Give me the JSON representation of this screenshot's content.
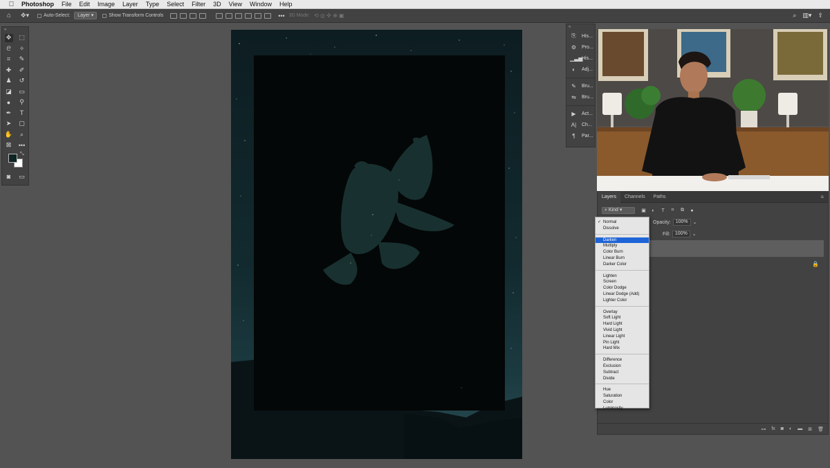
{
  "menubar": {
    "apple_icon": "apple-icon",
    "items": [
      "Photoshop",
      "File",
      "Edit",
      "Image",
      "Layer",
      "Type",
      "Select",
      "Filter",
      "3D",
      "View",
      "Window",
      "Help"
    ]
  },
  "options": {
    "auto_select_label": "Auto-Select:",
    "auto_select_value": "Layer",
    "show_transform_label": "Show Transform Controls",
    "mode_3d_label": "3D Mode:"
  },
  "mini_panels": [
    "His...",
    "Pro...",
    "His...",
    "Adj...",
    "Bru...",
    "Bru...",
    "Act...",
    "Ch...",
    "Par..."
  ],
  "layers": {
    "tabs": [
      "Layers",
      "Channels",
      "Paths"
    ],
    "kind_label": "Kind",
    "opacity_label": "Opacity:",
    "opacity_value": "100%",
    "fill_label": "Fill:",
    "fill_value": "100%"
  },
  "blend_modes": {
    "groups": [
      [
        "Normal",
        "Dissolve"
      ],
      [
        "Darken",
        "Multiply",
        "Color Burn",
        "Linear Burn",
        "Darker Color"
      ],
      [
        "Lighten",
        "Screen",
        "Color Dodge",
        "Linear Dodge (Add)",
        "Lighter Color"
      ],
      [
        "Overlay",
        "Soft Light",
        "Hard Light",
        "Vivid Light",
        "Linear Light",
        "Pin Light",
        "Hard Mix"
      ],
      [
        "Difference",
        "Exclusion",
        "Subtract",
        "Divide"
      ],
      [
        "Hue",
        "Saturation",
        "Color",
        "Luminosity"
      ]
    ],
    "checked": "Normal",
    "highlighted": "Darken"
  },
  "colors": {
    "foreground": "#0e2523",
    "background": "#ffffff",
    "highlight": "#1e64d7"
  }
}
